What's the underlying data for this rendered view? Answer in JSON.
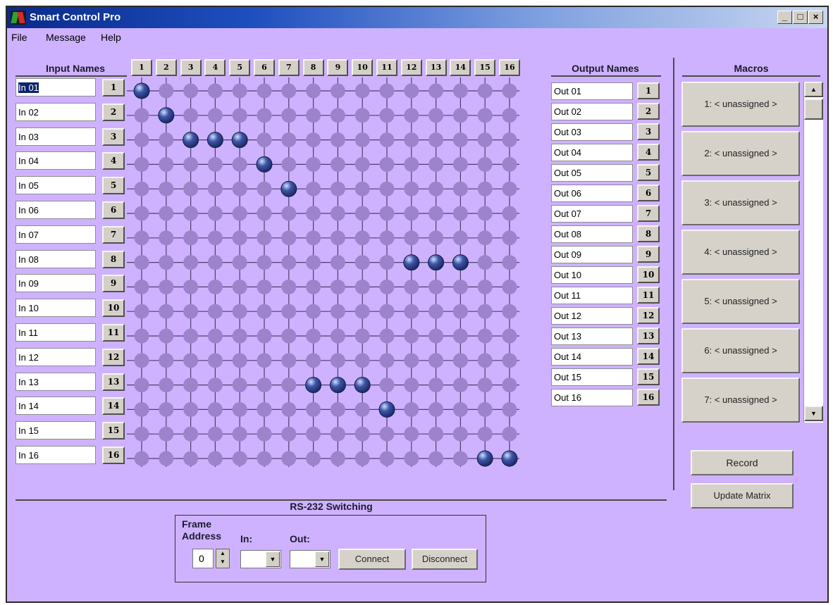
{
  "window": {
    "title": "Smart Control Pro"
  },
  "menu": [
    "File",
    "Message",
    "Help"
  ],
  "labels": {
    "input_names": "Input Names",
    "output_names": "Output Names",
    "macros": "Macros",
    "rs232": "RS-232 Switching"
  },
  "inputs": [
    "In 01",
    "In 02",
    "In 03",
    "In 04",
    "In 05",
    "In 06",
    "In 07",
    "In 08",
    "In 09",
    "In 10",
    "In 11",
    "In 12",
    "In 13",
    "In 14",
    "In 15",
    "In 16"
  ],
  "outputs": [
    "Out 01",
    "Out 02",
    "Out 03",
    "Out 04",
    "Out 05",
    "Out 06",
    "Out 07",
    "Out 08",
    "Out 09",
    "Out 10",
    "Out 11",
    "Out 12",
    "Out 13",
    "Out 14",
    "Out 15",
    "Out 16"
  ],
  "numbers": [
    "1",
    "2",
    "3",
    "4",
    "5",
    "6",
    "7",
    "8",
    "9",
    "10",
    "11",
    "12",
    "13",
    "14",
    "15",
    "16"
  ],
  "crosspoints": [
    [
      1,
      1
    ],
    [
      2,
      2
    ],
    [
      3,
      3
    ],
    [
      3,
      4
    ],
    [
      3,
      5
    ],
    [
      4,
      6
    ],
    [
      5,
      7
    ],
    [
      8,
      12
    ],
    [
      8,
      13
    ],
    [
      8,
      14
    ],
    [
      13,
      8
    ],
    [
      13,
      9
    ],
    [
      13,
      10
    ],
    [
      14,
      11
    ],
    [
      16,
      15
    ],
    [
      16,
      16
    ]
  ],
  "macros": [
    "1: < unassigned >",
    "2: < unassigned >",
    "3: < unassigned >",
    "4: < unassigned >",
    "5: < unassigned >",
    "6: < unassigned >",
    "7: < unassigned >"
  ],
  "buttons": {
    "record": "Record",
    "update_matrix": "Update Matrix",
    "connect": "Connect",
    "disconnect": "Disconnect"
  },
  "rs232": {
    "frame_label_1": "Frame",
    "frame_label_2": "Address",
    "in_label": "In:",
    "out_label": "Out:",
    "frame_address": "0",
    "in_value": "",
    "out_value": ""
  },
  "colors": {
    "background": "#cfb2ff",
    "node": "#9d82cc",
    "active_node": "#3e55a6",
    "grid_line": "#4b3f6a"
  }
}
